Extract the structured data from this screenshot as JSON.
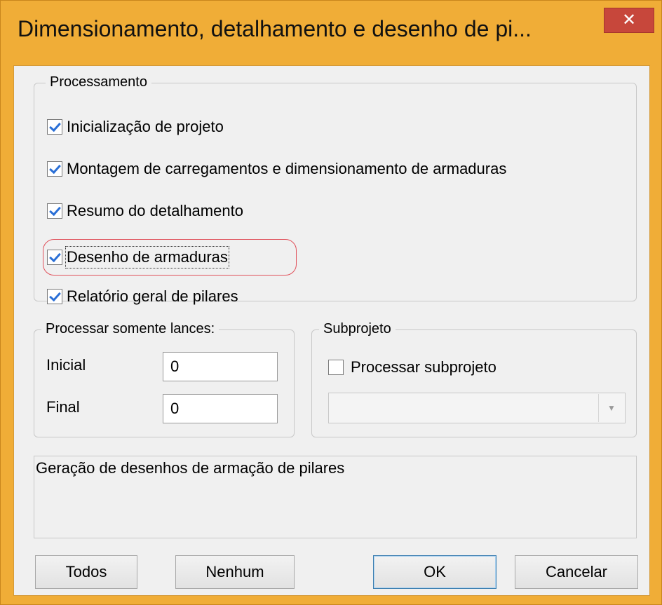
{
  "window": {
    "title": "Dimensionamento, detalhamento e desenho de pi...",
    "close_glyph": "✕"
  },
  "processing": {
    "group_title": "Processamento",
    "items": [
      {
        "label": "Inicialização de projeto",
        "checked": true
      },
      {
        "label": "Montagem de carregamentos e dimensionamento de armaduras",
        "checked": true
      },
      {
        "label": "Resumo do detalhamento",
        "checked": true
      },
      {
        "label": "Desenho de armaduras",
        "checked": true,
        "focused": true
      },
      {
        "label": "Relatório geral de pilares",
        "checked": true
      }
    ]
  },
  "lances": {
    "group_title": "Processar somente lances:",
    "initial_label": "Inicial",
    "initial_value": "0",
    "final_label": "Final",
    "final_value": "0"
  },
  "subproject": {
    "group_title": "Subprojeto",
    "checkbox_label": "Processar subprojeto",
    "checked": false,
    "combo_value": ""
  },
  "description": "Geração de desenhos de armação de pilares",
  "buttons": {
    "todos": "Todos",
    "nenhum": "Nenhum",
    "ok": "OK",
    "cancelar": "Cancelar"
  },
  "colors": {
    "title_bar": "#f0ad37",
    "close_button": "#c7473b",
    "focus_highlight": "#e0505a",
    "check_mark": "#2a6fd6"
  }
}
